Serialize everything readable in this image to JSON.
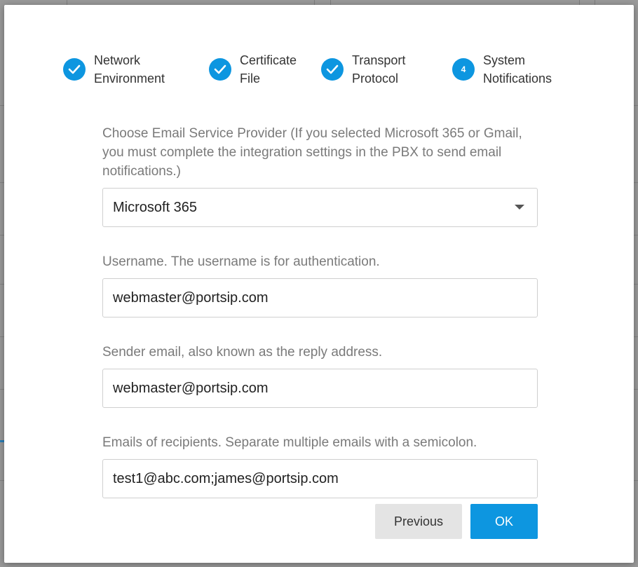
{
  "stepper": {
    "steps": [
      {
        "label": "Network\nEnvironment",
        "status": "complete",
        "icon": "check-icon"
      },
      {
        "label": "Certificate\nFile",
        "status": "complete",
        "icon": "check-icon"
      },
      {
        "label": "Transport\nProtocol",
        "status": "complete",
        "icon": "check-icon"
      },
      {
        "label": "System\nNotifications",
        "status": "current",
        "number": "4"
      }
    ]
  },
  "form": {
    "provider": {
      "label": "Choose Email Service Provider (If you selected Microsoft 365 or Gmail, you must complete the integration settings in the PBX to send email notifications.)",
      "value": "Microsoft 365"
    },
    "username": {
      "label": "Username. The username is for authentication.",
      "value": "webmaster@portsip.com"
    },
    "sender": {
      "label": "Sender email, also known as the reply address.",
      "value": "webmaster@portsip.com"
    },
    "recipients": {
      "label": "Emails of recipients. Separate multiple emails with a semicolon.",
      "value": "test1@abc.com;james@portsip.com"
    }
  },
  "buttons": {
    "previous": "Previous",
    "ok": "OK"
  },
  "colors": {
    "accent": "#0d96e0",
    "secondary_button": "#e4e4e4",
    "label_text": "#7a7a7a"
  }
}
